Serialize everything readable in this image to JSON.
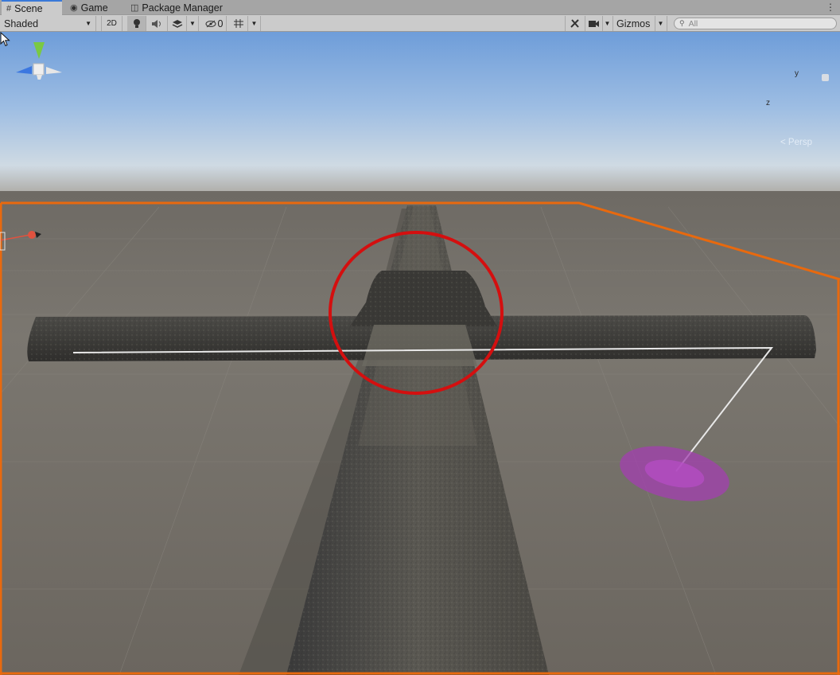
{
  "tabs": [
    {
      "label": "Scene",
      "icon": "grid-hash-icon",
      "active": true
    },
    {
      "label": "Game",
      "icon": "gamepad-icon",
      "active": false
    },
    {
      "label": "Package Manager",
      "icon": "package-icon",
      "active": false
    }
  ],
  "toolbar": {
    "shading_mode": "Shaded",
    "btn_2d": "2D",
    "hidden_count": "0",
    "gizmos": "Gizmos",
    "search_placeholder": "All"
  },
  "scene_gizmo": {
    "y_label": "y",
    "z_label": "z",
    "projection": "Persp"
  },
  "colors": {
    "selection_outline": "#e8690e",
    "annotation_circle": "#d40f0f",
    "brush_preview": "#a33fb0",
    "sky_top": "#6e9dd9",
    "ground": "#7a7670"
  }
}
